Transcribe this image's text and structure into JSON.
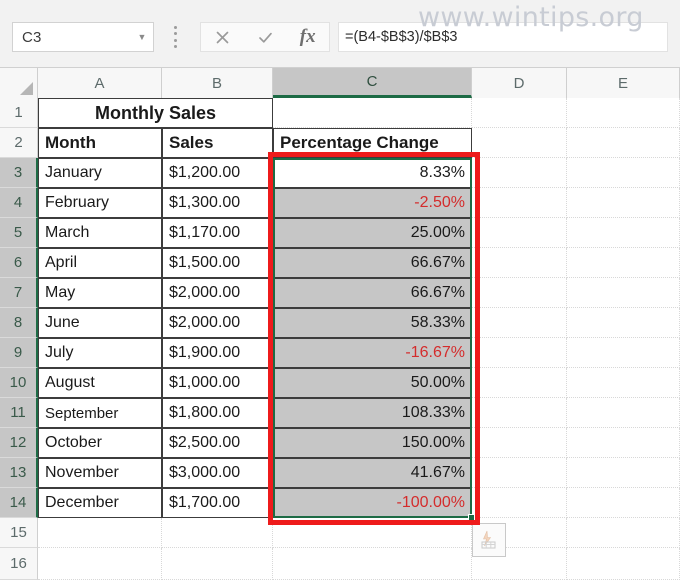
{
  "app": {
    "name": "Microsoft Excel",
    "watermark": "www.wintips.org"
  },
  "formula_bar": {
    "name_box_value": "C3",
    "name_box_caret_icon": "chevron-down-icon",
    "cancel_icon": "cancel-x-icon",
    "confirm_icon": "confirm-check-icon",
    "insert_function_icon": "fx-icon",
    "insert_function_label": "fx",
    "formula_value": "=(B4-$B$3)/$B$3"
  },
  "grid": {
    "select_all_icon": "select-all-corner-icon",
    "columns": [
      {
        "label": "A",
        "selected": false
      },
      {
        "label": "B",
        "selected": false
      },
      {
        "label": "C",
        "selected": true
      },
      {
        "label": "D",
        "selected": false
      },
      {
        "label": "E",
        "selected": false
      }
    ],
    "rows": [
      {
        "num": "1",
        "selected": false
      },
      {
        "num": "2",
        "selected": false
      },
      {
        "num": "3",
        "selected": true
      },
      {
        "num": "4",
        "selected": true
      },
      {
        "num": "5",
        "selected": true
      },
      {
        "num": "6",
        "selected": true
      },
      {
        "num": "7",
        "selected": true
      },
      {
        "num": "8",
        "selected": true
      },
      {
        "num": "9",
        "selected": true
      },
      {
        "num": "10",
        "selected": true
      },
      {
        "num": "11",
        "selected": true
      },
      {
        "num": "12",
        "selected": true
      },
      {
        "num": "13",
        "selected": true
      },
      {
        "num": "14",
        "selected": true
      },
      {
        "num": "15",
        "selected": false
      },
      {
        "num": "16",
        "selected": false
      }
    ],
    "title_cell": "Monthly Sales",
    "headers": {
      "month": "Month",
      "sales": "Sales",
      "percentage_change": "Percentage Change"
    },
    "data": [
      {
        "row": "3",
        "month": "January",
        "sales": "$1,200.00",
        "pct": "8.33%",
        "negative": false,
        "active": true
      },
      {
        "row": "4",
        "month": "February",
        "sales": "$1,300.00",
        "pct": "-2.50%",
        "negative": true,
        "active": false
      },
      {
        "row": "5",
        "month": "March",
        "sales": "$1,170.00",
        "pct": "25.00%",
        "negative": false,
        "active": false
      },
      {
        "row": "6",
        "month": "April",
        "sales": "$1,500.00",
        "pct": "66.67%",
        "negative": false,
        "active": false
      },
      {
        "row": "7",
        "month": "May",
        "sales": "$2,000.00",
        "pct": "66.67%",
        "negative": false,
        "active": false
      },
      {
        "row": "8",
        "month": "June",
        "sales": "$2,000.00",
        "pct": "58.33%",
        "negative": false,
        "active": false
      },
      {
        "row": "9",
        "month": "July",
        "sales": "$1,900.00",
        "pct": "-16.67%",
        "negative": true,
        "active": false
      },
      {
        "row": "10",
        "month": "August",
        "sales": "$1,000.00",
        "pct": "50.00%",
        "negative": false,
        "active": false
      },
      {
        "row": "11",
        "month": "September",
        "sales": "$1,800.00",
        "pct": "108.33%",
        "negative": false,
        "active": false
      },
      {
        "row": "12",
        "month": "October",
        "sales": "$2,500.00",
        "pct": "150.00%",
        "negative": false,
        "active": false
      },
      {
        "row": "13",
        "month": "November",
        "sales": "$3,000.00",
        "pct": "41.67%",
        "negative": false,
        "active": false
      },
      {
        "row": "14",
        "month": "December",
        "sales": "$1,700.00",
        "pct": "-100.00%",
        "negative": true,
        "active": false
      }
    ],
    "fill_handle_icon": "fill-handle-icon",
    "quick_analysis_icon": "quick-analysis-icon"
  },
  "annotation": {
    "shape": "rectangle",
    "color": "#ee1b1b",
    "target": "C3:C14"
  },
  "colors": {
    "selection_green": "#1d6b45",
    "selection_fill": "#c6c6c6",
    "negative_red": "#d42c2c",
    "annotation_red": "#ee1b1b",
    "header_gray": "#f7f7f7"
  }
}
